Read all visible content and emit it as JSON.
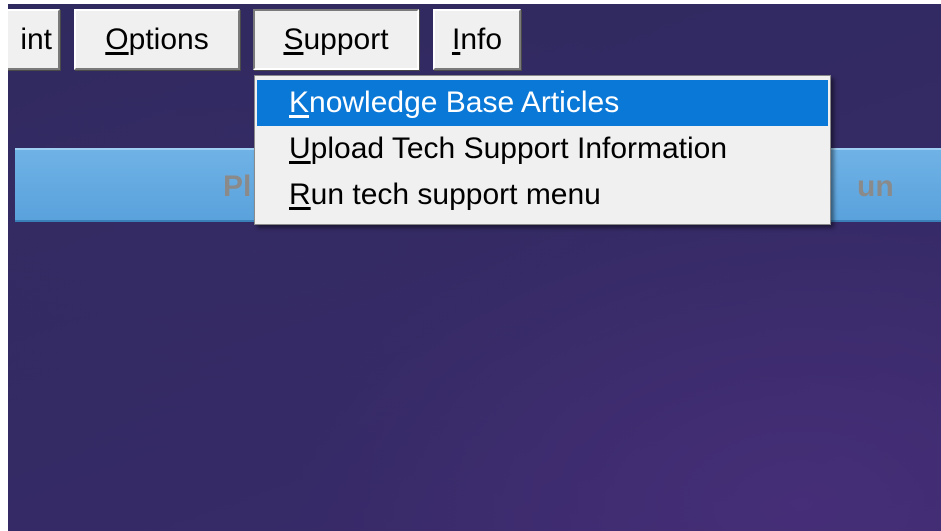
{
  "menu_bar": {
    "print": {
      "text": "int"
    },
    "options": {
      "mnemonic": "O",
      "rest": "ptions"
    },
    "support": {
      "mnemonic": "S",
      "rest": "upport"
    },
    "info": {
      "mnemonic": "I",
      "rest": "nfo"
    }
  },
  "banner": {
    "left_text": "Pl",
    "right_text": "un"
  },
  "support_menu": {
    "items": [
      {
        "mnemonic": "K",
        "rest": "nowledge Base Articles",
        "highlighted": true
      },
      {
        "mnemonic": "U",
        "rest": "pload Tech Support Information",
        "highlighted": false
      },
      {
        "mnemonic": "R",
        "rest": "un tech support menu",
        "highlighted": false
      }
    ]
  },
  "colors": {
    "background": "#332a63",
    "banner": "#5aa2dc",
    "menu_highlight": "#0a78d7"
  }
}
